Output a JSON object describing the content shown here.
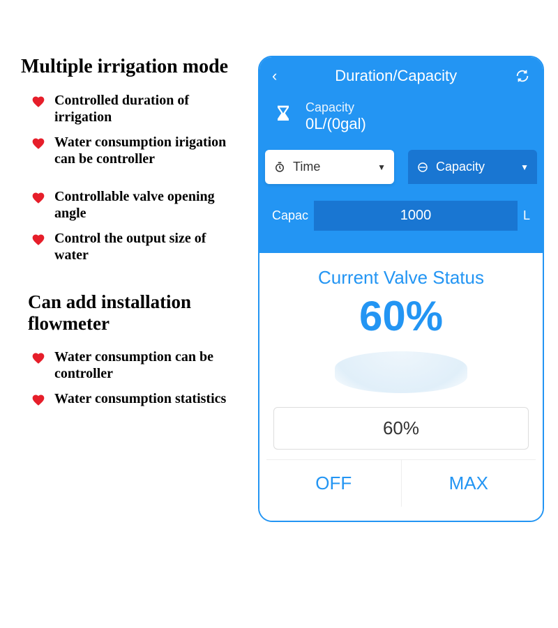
{
  "left": {
    "title1": "Multiple irrigation mode",
    "bullets1": [
      "Controlled duration of irrigation",
      "Water consumption irigation can be controller",
      "Controllable valve opening angle",
      "Control the output size of water"
    ],
    "title2": "Can add installation flowmeter",
    "bullets2": [
      "Water consumption can be controller",
      "Water consumption statistics"
    ]
  },
  "phone": {
    "header_title": "Duration/Capacity",
    "capacity_label": "Capacity",
    "capacity_value": "0L/(0gal)",
    "tab_time": "Time",
    "tab_capacity": "Capacity",
    "input_label": "Capac",
    "input_value": "1000",
    "input_unit": "L",
    "valve_title": "Current Valve Status",
    "valve_percent": "60%",
    "slider_value": "60%",
    "off_label": "OFF",
    "max_label": "MAX"
  }
}
